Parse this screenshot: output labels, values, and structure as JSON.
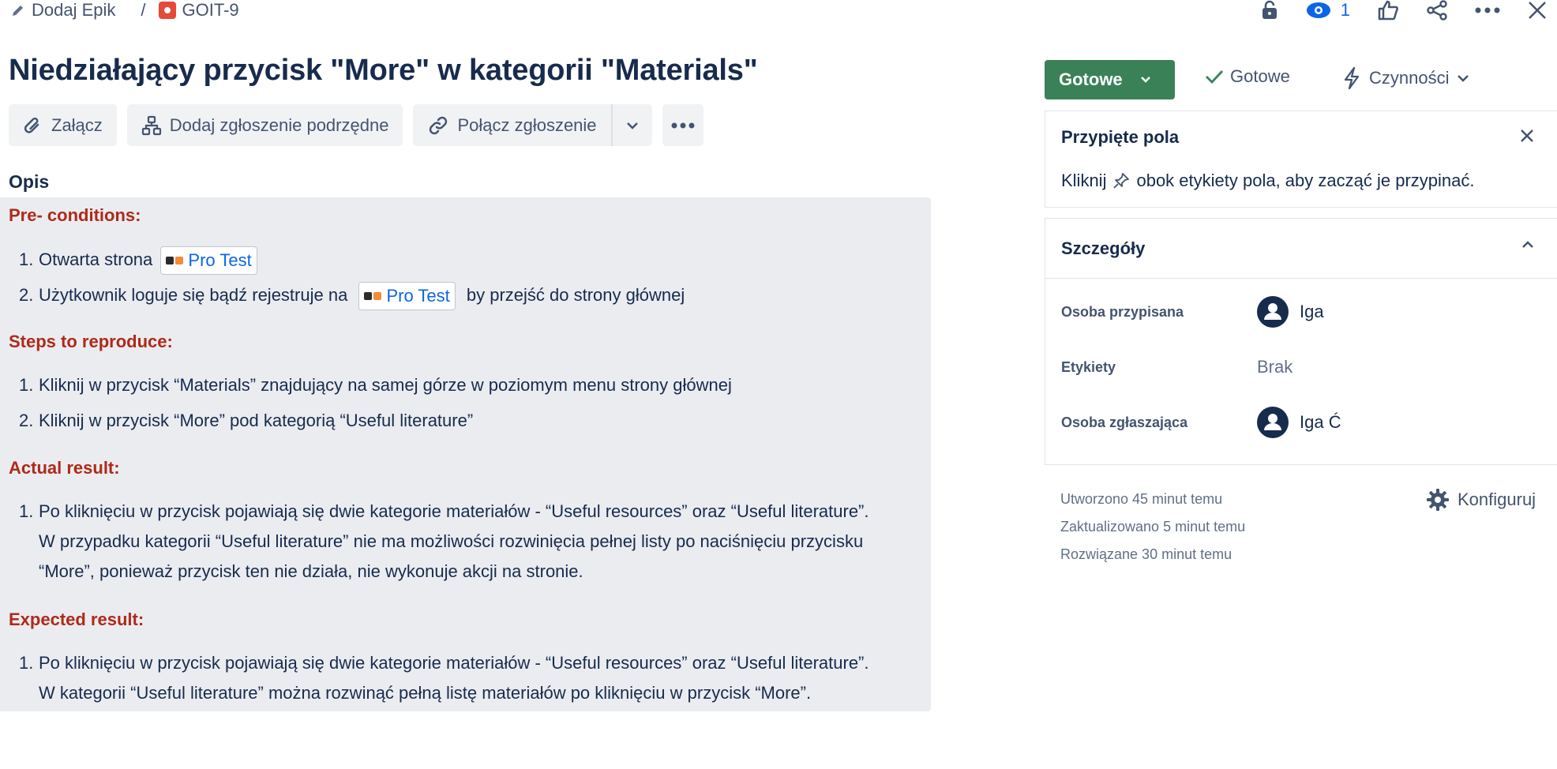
{
  "breadcrumb": {
    "epic_label": "Dodaj Epik",
    "separator": "/",
    "issue_key": "GOIT-9"
  },
  "topbar": {
    "watchers_count": "1"
  },
  "issue": {
    "title": "Niedziałający przycisk \"More\" w kategorii \"Materials\""
  },
  "actions": {
    "attach": "Załącz",
    "add_child": "Dodaj zgłoszenie podrzędne",
    "link_issue": "Połącz zgłoszenie"
  },
  "description": {
    "heading": "Opis",
    "sections": {
      "pre": {
        "heading": "Pre- conditions:",
        "item1_num": "1.",
        "item1_text": "Otwarta strona",
        "item2_num": "2.",
        "item2_before": "Użytkownik loguje się bądź rejestruje na",
        "item2_after": "by przejść do strony głównej",
        "chip_label": "Pro Test"
      },
      "steps": {
        "heading": "Steps to reproduce:",
        "item1": "Kliknij w przycisk “Materials” znajdujący na samej górze w poziomym menu strony głównej",
        "item2": "Kliknij w przycisk “More” pod kategorią “Useful literature”"
      },
      "actual": {
        "heading": "Actual result:",
        "line1": "Po kliknięciu w przycisk pojawiają się dwie kategorie materiałów - “Useful resources” oraz “Useful literature”.",
        "line2": "W przypadku kategorii “Useful literature” nie ma możliwości rozwinięcia pełnej listy po naciśnięciu przycisku",
        "line3": "“More”, ponieważ przycisk ten nie działa, nie wykonuje akcji na stronie."
      },
      "expected": {
        "heading": "Expected result:",
        "line1": "Po kliknięciu w przycisk pojawiają się dwie kategorie materiałów - “Useful resources” oraz “Useful literature”.",
        "line2": "W kategorii “Useful literature” można rozwinąć pełną listę materiałów po kliknięciu w przycisk “More”."
      }
    }
  },
  "status": {
    "label": "Gotowe",
    "resolution": "Gotowe",
    "actions_menu": "Czynności",
    "color": "#3a8158"
  },
  "pinned": {
    "title": "Przypięte pola",
    "text_before": "Kliknij",
    "text_after": "obok etykiety pola, aby zacząć je przypinać."
  },
  "details": {
    "title": "Szczegóły",
    "assignee_label": "Osoba przypisana",
    "assignee_value": "Iga",
    "labels_label": "Etykiety",
    "labels_value": "Brak",
    "reporter_label": "Osoba zgłaszająca",
    "reporter_value": "Iga Ć"
  },
  "meta": {
    "created": "Utworzono 45 minut temu",
    "updated": "Zaktualizowano 5 minut temu",
    "resolved": "Rozwiązane 30 minut temu",
    "configure": "Konfiguruj"
  },
  "icons": [
    "pencil-icon",
    "bug-icon",
    "lock-icon",
    "eye-icon",
    "thumbs-up-icon",
    "share-icon",
    "more-icon",
    "close-icon",
    "paperclip-icon",
    "hierarchy-icon",
    "link-icon",
    "chevron-down-icon",
    "check-icon",
    "lightning-icon",
    "pin-icon",
    "chevron-up-icon",
    "user-avatar-icon",
    "gear-icon"
  ]
}
